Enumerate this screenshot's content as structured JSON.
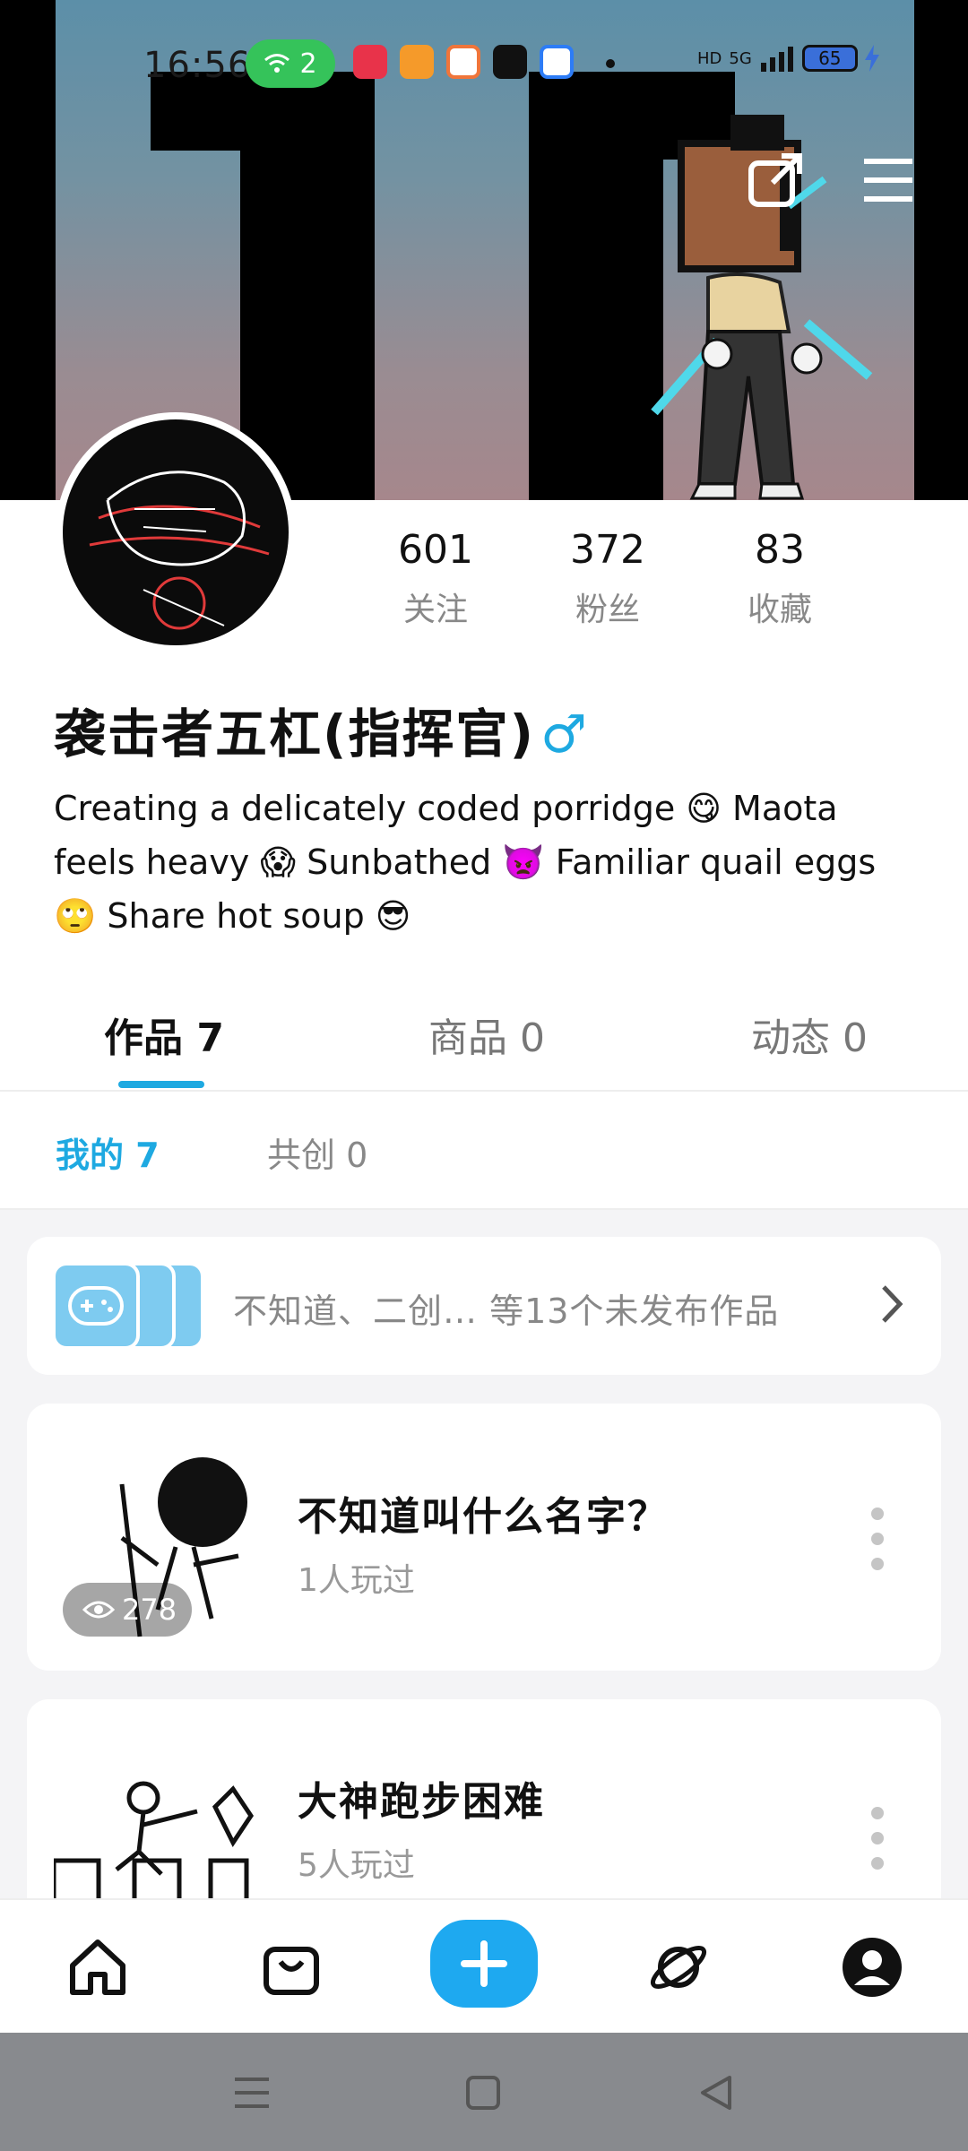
{
  "status_bar": {
    "time": "16:56",
    "hotspot_count": "2",
    "battery": "65",
    "network": "5G",
    "hd_label": "HD"
  },
  "header": {
    "share_icon": "share-icon",
    "menu_icon": "menu-icon"
  },
  "profile": {
    "stats": [
      {
        "value": "601",
        "label": "关注"
      },
      {
        "value": "372",
        "label": "粉丝"
      },
      {
        "value": "83",
        "label": "收藏"
      }
    ],
    "nickname": "袭击者五杠(指挥官)",
    "gender_symbol": "♂",
    "bio": "Creating a delicately coded porridge 😋 Maota feels heavy 😱 Sunbathed 👿 Familiar quail eggs 🙄 Share hot soup 😎"
  },
  "tabs": [
    {
      "label": "作品 7",
      "active": true
    },
    {
      "label": "商品 0",
      "active": false
    },
    {
      "label": "动态 0",
      "active": false
    }
  ],
  "subtabs": [
    {
      "label": "我的 7",
      "active": true
    },
    {
      "label": "共创 0",
      "active": false
    }
  ],
  "drafts": {
    "text": "不知道、二创…  等13个未发布作品"
  },
  "works": [
    {
      "title": "不知道叫什么名字？",
      "players": "1人玩过",
      "views": "278"
    },
    {
      "title": "大神跑步困难",
      "players": "5人玩过"
    }
  ],
  "bottom_nav": [
    "home-icon",
    "bag-icon",
    "add-icon",
    "planet-icon",
    "profile-icon"
  ],
  "colors": {
    "accent": "#1ea9e1",
    "gender": "#1ea9e1",
    "add_button": "#1ea9f0"
  }
}
